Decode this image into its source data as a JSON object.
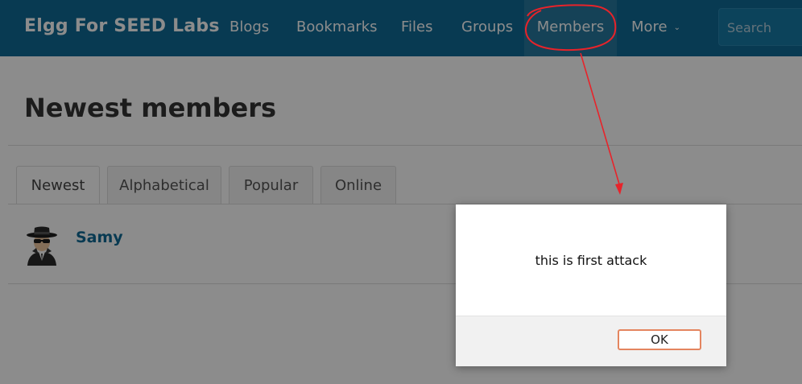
{
  "site": {
    "brand": "Elgg For SEED Labs"
  },
  "nav": {
    "items": [
      {
        "label": "Blogs"
      },
      {
        "label": "Bookmarks"
      },
      {
        "label": "Files"
      },
      {
        "label": "Groups"
      },
      {
        "label": "Members",
        "active": true
      },
      {
        "label": "More"
      }
    ],
    "search_placeholder": "Search"
  },
  "page": {
    "title": "Newest members",
    "tabs": [
      {
        "label": "Newest",
        "active": true
      },
      {
        "label": "Alphabetical"
      },
      {
        "label": "Popular"
      },
      {
        "label": "Online"
      }
    ],
    "members": [
      {
        "name": "Samy",
        "avatar_icon": "spy-avatar-icon"
      }
    ]
  },
  "alert": {
    "message": "this is first attack",
    "ok_label": "OK"
  },
  "colors": {
    "nav_background": "#0f6a95",
    "link": "#0f6a95",
    "annotation": "#e8232a",
    "ok_button_border": "#e4855f"
  }
}
